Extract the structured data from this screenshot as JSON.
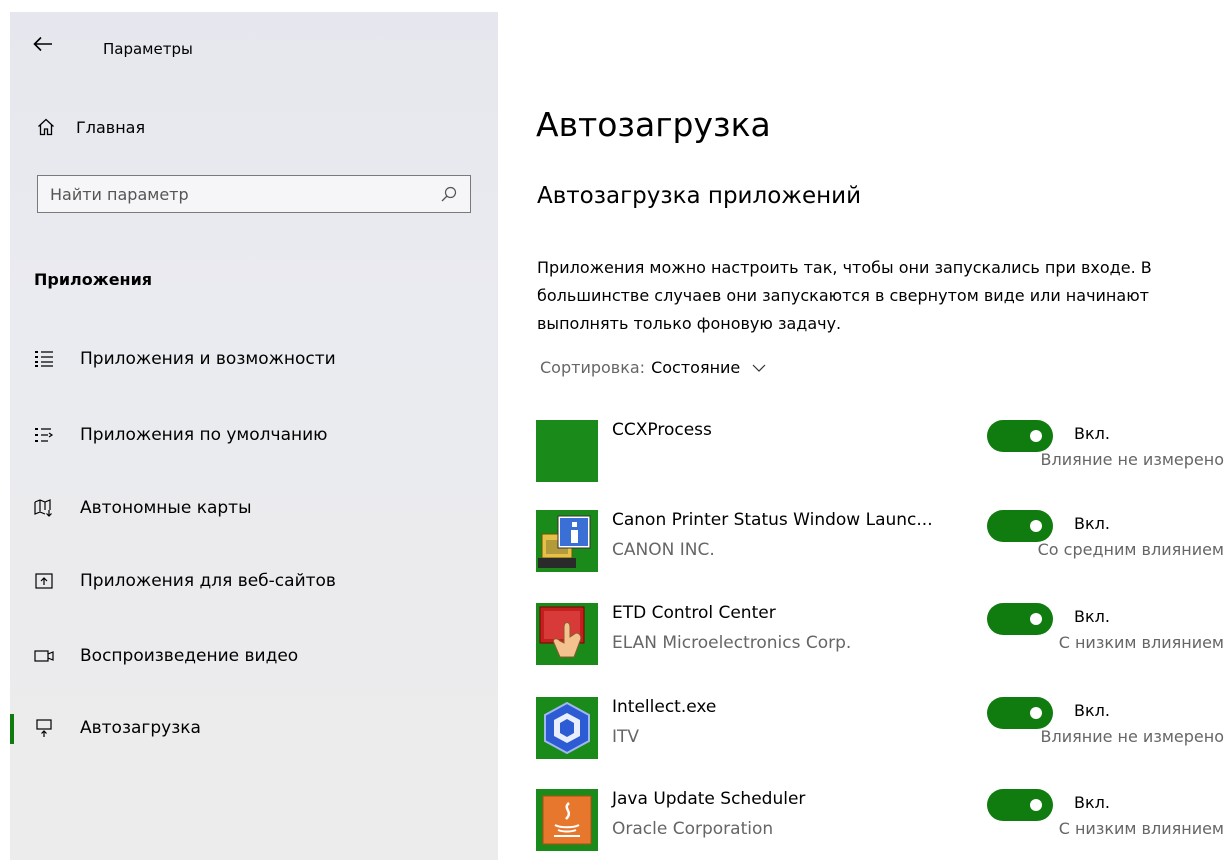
{
  "window": {
    "title": "Параметры"
  },
  "sidebar": {
    "home_label": "Главная",
    "search_placeholder": "Найти параметр",
    "section_title": "Приложения",
    "items": [
      {
        "label": "Приложения и возможности",
        "icon": "apps-features-icon"
      },
      {
        "label": "Приложения по умолчанию",
        "icon": "default-apps-icon"
      },
      {
        "label": "Автономные карты",
        "icon": "offline-maps-icon"
      },
      {
        "label": "Приложения для веб-сайтов",
        "icon": "apps-websites-icon"
      },
      {
        "label": "Воспроизведение видео",
        "icon": "video-playback-icon"
      },
      {
        "label": "Автозагрузка",
        "icon": "startup-icon",
        "active": true
      }
    ],
    "active_color": "#107c10"
  },
  "main": {
    "title": "Автозагрузка",
    "subtitle": "Автозагрузка приложений",
    "description": "Приложения можно настроить так, чтобы они запускались при входе. В большинстве случаев они запускаются в свернутом виде или начинают выполнять только фоновую задачу.",
    "sort": {
      "label": "Сортировка:",
      "value": "Состояние"
    },
    "apps": [
      {
        "name": "CCXProcess",
        "publisher": "",
        "state": "Вкл.",
        "impact": "Влияние не измерено",
        "enabled": true,
        "icon": "ccxprocess-icon"
      },
      {
        "name": "Canon Printer Status Window Launc...",
        "publisher": "CANON INC.",
        "state": "Вкл.",
        "impact": "Со средним влиянием",
        "enabled": true,
        "icon": "canon-printer-icon"
      },
      {
        "name": "ETD Control Center",
        "publisher": "ELAN Microelectronics Corp.",
        "state": "Вкл.",
        "impact": "С низким влиянием",
        "enabled": true,
        "icon": "etd-touchpad-icon"
      },
      {
        "name": "Intellect.exe",
        "publisher": "ITV",
        "state": "Вкл.",
        "impact": "Влияние не измерено",
        "enabled": true,
        "icon": "intellect-icon"
      },
      {
        "name": "Java Update Scheduler",
        "publisher": "Oracle Corporation",
        "state": "Вкл.",
        "impact": "С низким влиянием",
        "enabled": true,
        "icon": "java-icon"
      }
    ],
    "toggle_color": "#107c10"
  }
}
